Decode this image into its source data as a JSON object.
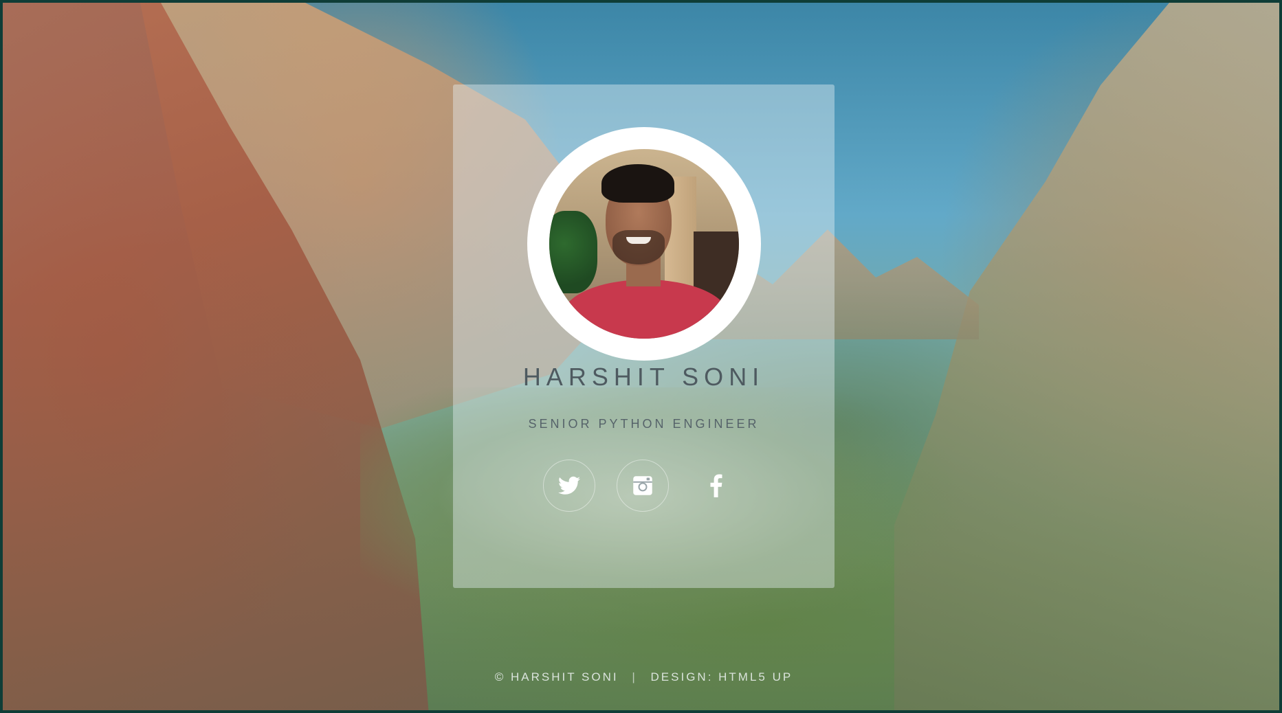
{
  "profile": {
    "name": "HARSHIT SONI",
    "title": "SENIOR PYTHON ENGINEER"
  },
  "social": [
    {
      "icon": "twitter-icon",
      "label": "Twitter"
    },
    {
      "icon": "instagram-icon",
      "label": "Instagram"
    },
    {
      "icon": "facebook-icon",
      "label": "Facebook"
    }
  ],
  "footer": {
    "copyright": "© HARSHIT SONI",
    "separator": "|",
    "design": "DESIGN: HTML5 UP"
  },
  "colors": {
    "card_bg": "#e6f0f5",
    "text": "#4e5a60",
    "frame_border": "#0f3d37",
    "icon": "#ffffff"
  }
}
